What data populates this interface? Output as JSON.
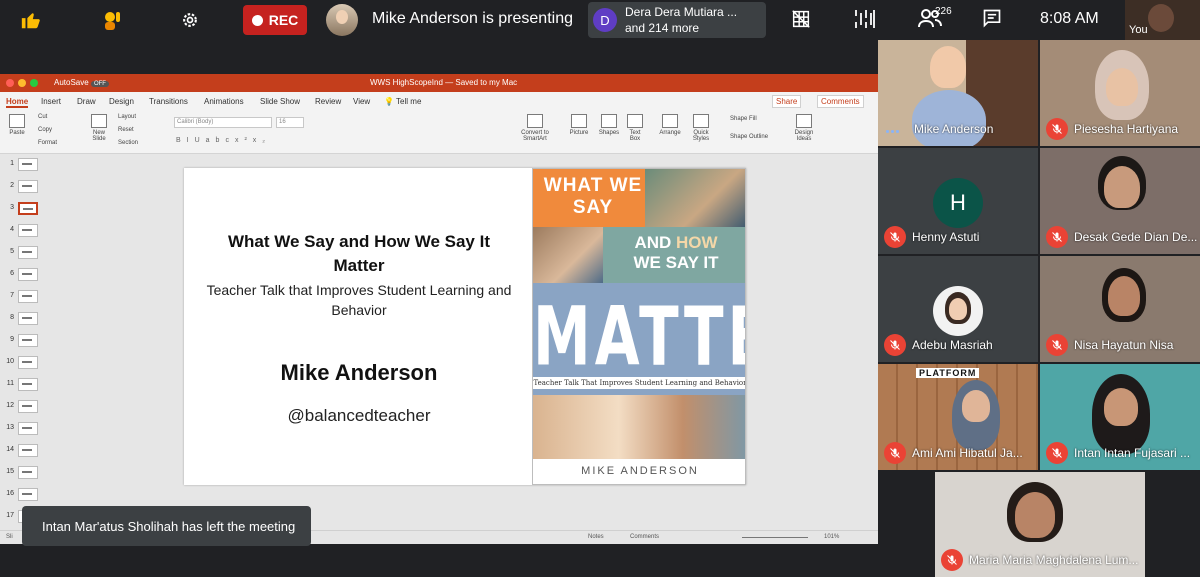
{
  "topbar": {
    "rec_label": "REC",
    "presenting_text": "Mike Anderson is presenting",
    "join": {
      "avatar_letter": "D",
      "line1": "Dera Dera Mutiara ...",
      "line2": "and 214 more"
    },
    "participant_count": "226",
    "time": "8:08 AM",
    "self_label": "You",
    "icons": [
      "thumbs-up-icon",
      "raise-hand-icon",
      "gear-icon",
      "grid-off-icon",
      "scan-icon",
      "people-icon",
      "chat-icon"
    ]
  },
  "powerpoint": {
    "autosave": "AutoSave",
    "autosave_state": "OFF",
    "doc_title": "WWS HighScopeInd — Saved to my Mac",
    "tabs": [
      "Home",
      "Insert",
      "Draw",
      "Design",
      "Transitions",
      "Animations",
      "Slide Show",
      "Review",
      "View",
      "Tell me"
    ],
    "share_label": "Share",
    "comments_label": "Comments",
    "ribbon": {
      "paste": "Paste",
      "cut": "Cut",
      "copy": "Copy",
      "format": "Format",
      "new_slide": "New Slide",
      "layout": "Layout",
      "reset": "Reset",
      "section": "Section",
      "font_name": "Calibri (Body)",
      "font_size": "16",
      "convert": "Convert to SmartArt",
      "picture": "Picture",
      "shapes": "Shapes",
      "textbox": "Text Box",
      "arrange": "Arrange",
      "quick_styles": "Quick Styles",
      "shape_fill": "Shape Fill",
      "shape_outline": "Shape Outline",
      "design_ideas": "Design Ideas"
    },
    "slide_numbers": [
      "1",
      "2",
      "3",
      "4",
      "5",
      "6",
      "7",
      "8",
      "9",
      "10",
      "11",
      "12",
      "13",
      "14",
      "15",
      "16",
      "17"
    ],
    "selected_slide": 3,
    "slide": {
      "title": "What We Say and How We Say It Matter",
      "subtitle": "Teacher Talk that Improves Student Learning and Behavior",
      "author": "Mike Anderson",
      "handle": "@balancedteacher"
    },
    "book": {
      "what_we_say": "WHAT WE SAY",
      "and": "AND",
      "how": "HOW",
      "we_say_it": "WE SAY IT",
      "matter": "MATTER",
      "strip": "Teacher Talk That Improves Student Learning and Behavior",
      "author": "MIKE ANDERSON"
    },
    "status": {
      "notes": "Notes",
      "comments": "Comments",
      "zoom": "101%"
    },
    "slide_counter": "Sli"
  },
  "toast": "Intan Mar'atus Sholihah has left the meeting",
  "participants": [
    {
      "name": "Mike Anderson",
      "muted": false
    },
    {
      "name": "Piesesha Hartiyana",
      "muted": true
    },
    {
      "name": "Henny Astuti",
      "muted": true,
      "letter": "H"
    },
    {
      "name": "Desak Gede Dian De...",
      "muted": true
    },
    {
      "name": "Adebu Masriah",
      "muted": true
    },
    {
      "name": "Nisa Hayatun Nisa",
      "muted": true
    },
    {
      "name": "Ami Ami Hibatul Ja...",
      "muted": true,
      "badge": "PLATFORM"
    },
    {
      "name": "Intan Intan Fujasari ...",
      "muted": true
    },
    {
      "name": "Maria Maria Maghdalena Lum...",
      "muted": true
    }
  ],
  "colors": {
    "accent_red": "#ea4335",
    "ppt_orange": "#c43e1c",
    "rec_red": "#c5221f",
    "bg": "#202124"
  }
}
